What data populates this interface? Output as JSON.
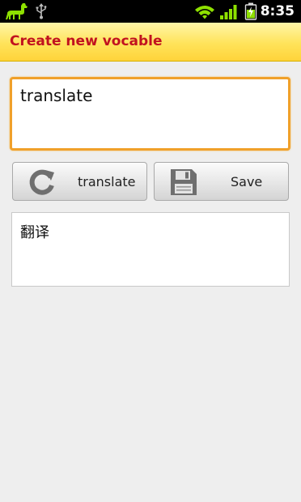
{
  "status_bar": {
    "time": "8:35",
    "icons": [
      "app-llama-icon",
      "usb-icon",
      "wifi-icon",
      "signal-icon",
      "battery-charging-icon"
    ]
  },
  "title_bar": {
    "title": "Create new vocable"
  },
  "input": {
    "value": "translate"
  },
  "buttons": {
    "translate_label": "translate",
    "save_label": "Save"
  },
  "result": {
    "text": "翻译"
  },
  "colors": {
    "title_text": "#c1121f",
    "title_bar": "#ffe35a",
    "focus_border": "#f0a02a",
    "status_green": "#8ee000"
  }
}
